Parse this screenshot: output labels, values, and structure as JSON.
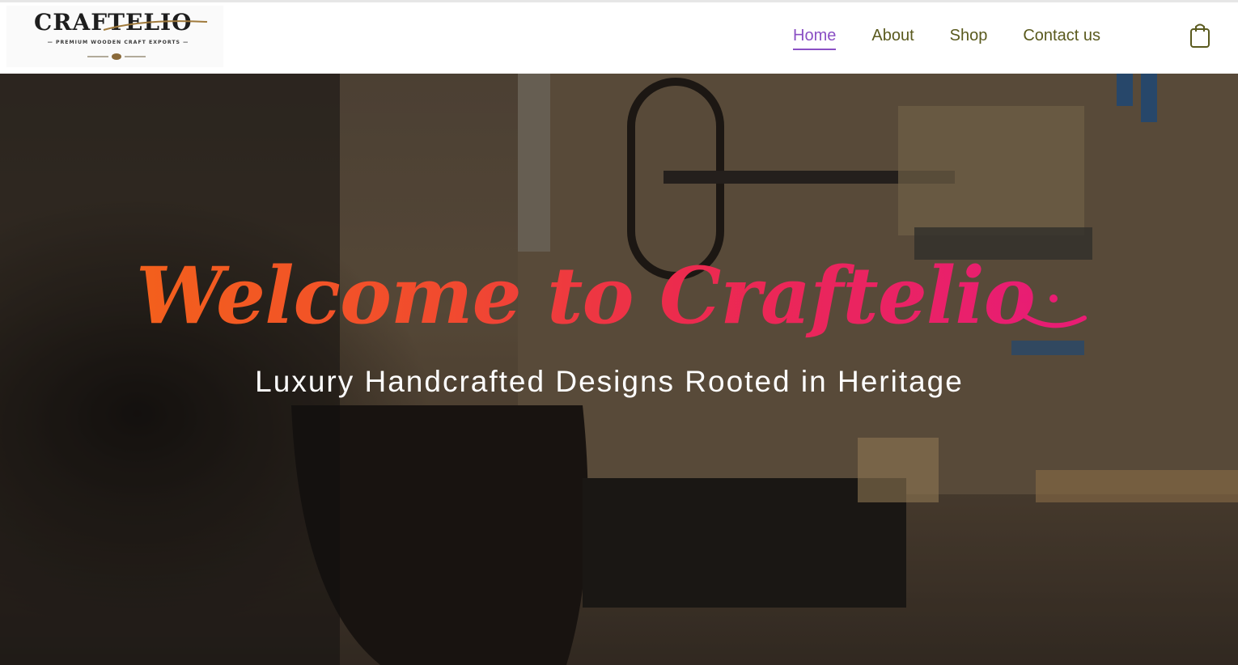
{
  "brand": {
    "name": "CRAFTELIO",
    "tagline": "— PREMIUM WOODEN CRAFT EXPORTS —"
  },
  "nav": {
    "items": [
      {
        "label": "Home",
        "active": true
      },
      {
        "label": "About",
        "active": false
      },
      {
        "label": "Shop",
        "active": false
      },
      {
        "label": "Contact us",
        "active": false
      }
    ],
    "active_color": "#8a4fc4",
    "color": "#5a5a1e"
  },
  "cart": {
    "icon": "shopping-bag-icon"
  },
  "hero": {
    "title": "Welcome to Craftelio",
    "subtitle": "Luxury Handcrafted Designs Rooted in Heritage",
    "title_gradient": [
      "#f3601c",
      "#e81d73"
    ],
    "emoji_icon": "smiley-icon"
  }
}
